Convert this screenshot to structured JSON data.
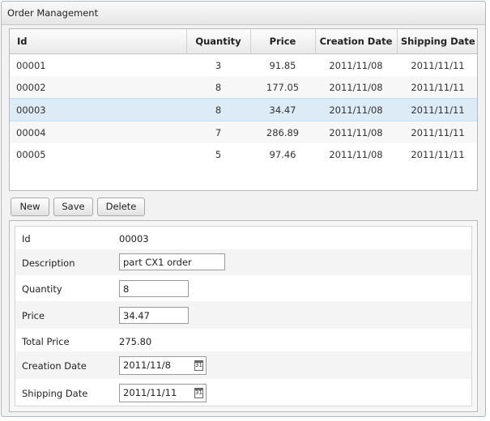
{
  "panel": {
    "title": "Order Management"
  },
  "grid": {
    "columns": [
      "Id",
      "Quantity",
      "Price",
      "Creation Date",
      "Shipping Date"
    ],
    "rows": [
      [
        "00001",
        "3",
        "91.85",
        "2011/11/08",
        "2011/11/11"
      ],
      [
        "00002",
        "8",
        "177.05",
        "2011/11/08",
        "2011/11/11"
      ],
      [
        "00003",
        "8",
        "34.47",
        "2011/11/08",
        "2011/11/11"
      ],
      [
        "00004",
        "7",
        "286.89",
        "2011/11/08",
        "2011/11/11"
      ],
      [
        "00005",
        "5",
        "97.46",
        "2011/11/08",
        "2011/11/11"
      ]
    ],
    "selected_index": 2
  },
  "toolbar": {
    "new_label": "New",
    "save_label": "Save",
    "delete_label": "Delete"
  },
  "form": {
    "id_label": "Id",
    "id_value": "00003",
    "description_label": "Description",
    "description_value": "part CX1 order",
    "quantity_label": "Quantity",
    "quantity_value": "8",
    "price_label": "Price",
    "price_value": "34.47",
    "total_price_label": "Total Price",
    "total_price_value": "275.80",
    "creation_date_label": "Creation Date",
    "creation_date_value": "2011/11/8",
    "shipping_date_label": "Shipping Date",
    "shipping_date_value": "2011/11/11",
    "calendar_glyph": "31"
  },
  "colors": {
    "selected_row": "#ddebf7",
    "border": "#a9b8c8"
  },
  "icons": {
    "date_picker": "calendar-icon"
  }
}
